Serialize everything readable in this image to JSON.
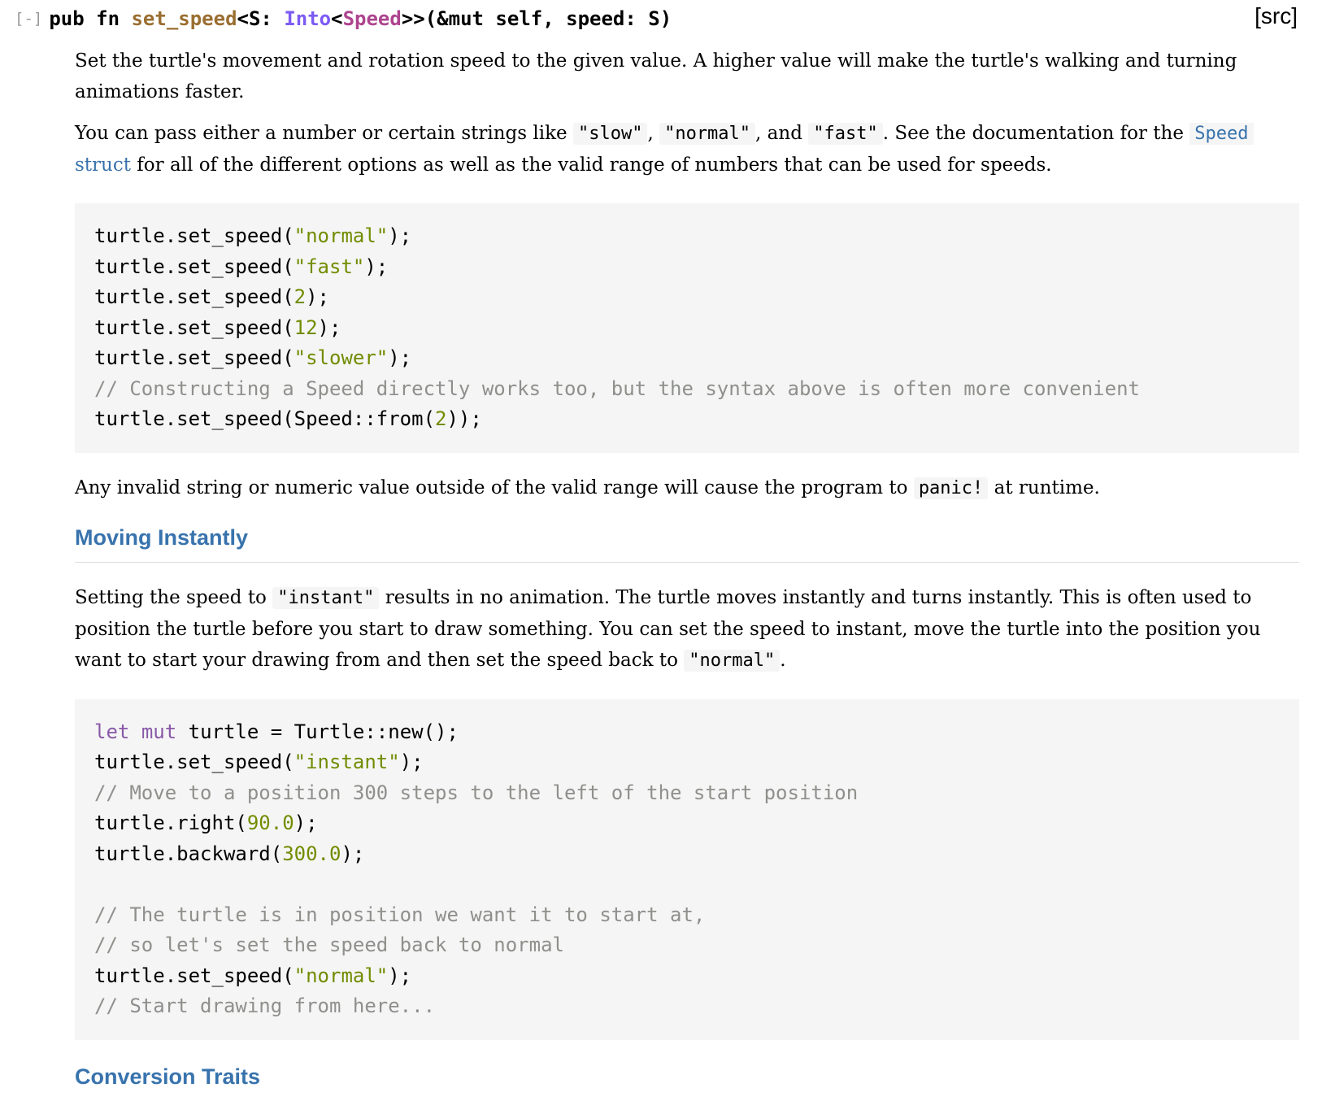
{
  "signature": {
    "toggle": "[-]",
    "prefix": "pub fn ",
    "name": "set_speed",
    "generic_open": "<S: ",
    "trait": "Into",
    "lt": "<",
    "type": "Speed",
    "rest": ">>(&mut self, speed: S)",
    "src_link": "[src]"
  },
  "para1": "Set the turtle's movement and rotation speed to the given value. A higher value will make the turtle's walking and turning animations faster.",
  "para2": {
    "t1": "You can pass either a number or certain strings like ",
    "c1": "\"slow\"",
    "t2": ", ",
    "c2": "\"normal\"",
    "t3": ", and ",
    "c3": "\"fast\"",
    "t4": ". See the documentation for the ",
    "link_code": "Speed",
    "link_text": " struct",
    "t5": " for all of the different options as well as the valid range of numbers that can be used for speeds."
  },
  "code1": {
    "lines": [
      [
        {
          "t": "turtle.set_speed("
        },
        {
          "t": "\"normal\"",
          "c": "str"
        },
        {
          "t": ");"
        }
      ],
      [
        {
          "t": "turtle.set_speed("
        },
        {
          "t": "\"fast\"",
          "c": "str"
        },
        {
          "t": ");"
        }
      ],
      [
        {
          "t": "turtle.set_speed("
        },
        {
          "t": "2",
          "c": "num"
        },
        {
          "t": ");"
        }
      ],
      [
        {
          "t": "turtle.set_speed("
        },
        {
          "t": "12",
          "c": "num"
        },
        {
          "t": ");"
        }
      ],
      [
        {
          "t": "turtle.set_speed("
        },
        {
          "t": "\"slower\"",
          "c": "str"
        },
        {
          "t": ");"
        }
      ],
      [
        {
          "t": "// Constructing a Speed directly works too, but the syntax above is often more convenient",
          "c": "cmt"
        }
      ],
      [
        {
          "t": "turtle.set_speed(Speed::from("
        },
        {
          "t": "2",
          "c": "num"
        },
        {
          "t": "));"
        }
      ]
    ]
  },
  "para3": {
    "t1": "Any invalid string or numeric value outside of the valid range will cause the program to ",
    "c1": "panic!",
    "t2": " at runtime."
  },
  "heading1": "Moving Instantly",
  "para4": {
    "t1": "Setting the speed to ",
    "c1": "\"instant\"",
    "t2": " results in no animation. The turtle moves instantly and turns instantly. This is often used to position the turtle before you start to draw something. You can set the speed to instant, move the turtle into the position you want to start your drawing from and then set the speed back to ",
    "c2": "\"normal\"",
    "t3": "."
  },
  "code2": {
    "lines": [
      [
        {
          "t": "let",
          "c": "kw"
        },
        {
          "t": " "
        },
        {
          "t": "mut",
          "c": "kw"
        },
        {
          "t": " turtle = Turtle::new();"
        }
      ],
      [
        {
          "t": "turtle.set_speed("
        },
        {
          "t": "\"instant\"",
          "c": "str"
        },
        {
          "t": ");"
        }
      ],
      [
        {
          "t": "// Move to a position 300 steps to the left of the start position",
          "c": "cmt"
        }
      ],
      [
        {
          "t": "turtle.right("
        },
        {
          "t": "90.0",
          "c": "num"
        },
        {
          "t": ");"
        }
      ],
      [
        {
          "t": "turtle.backward("
        },
        {
          "t": "300.0",
          "c": "num"
        },
        {
          "t": ");"
        }
      ],
      [
        {
          "t": ""
        }
      ],
      [
        {
          "t": "// The turtle is in position we want it to start at,",
          "c": "cmt"
        }
      ],
      [
        {
          "t": "// so let's set the speed back to normal",
          "c": "cmt"
        }
      ],
      [
        {
          "t": "turtle.set_speed("
        },
        {
          "t": "\"normal\"",
          "c": "str"
        },
        {
          "t": ");"
        }
      ],
      [
        {
          "t": "// Start drawing from here...",
          "c": "cmt"
        }
      ]
    ]
  },
  "heading2": "Conversion Traits"
}
